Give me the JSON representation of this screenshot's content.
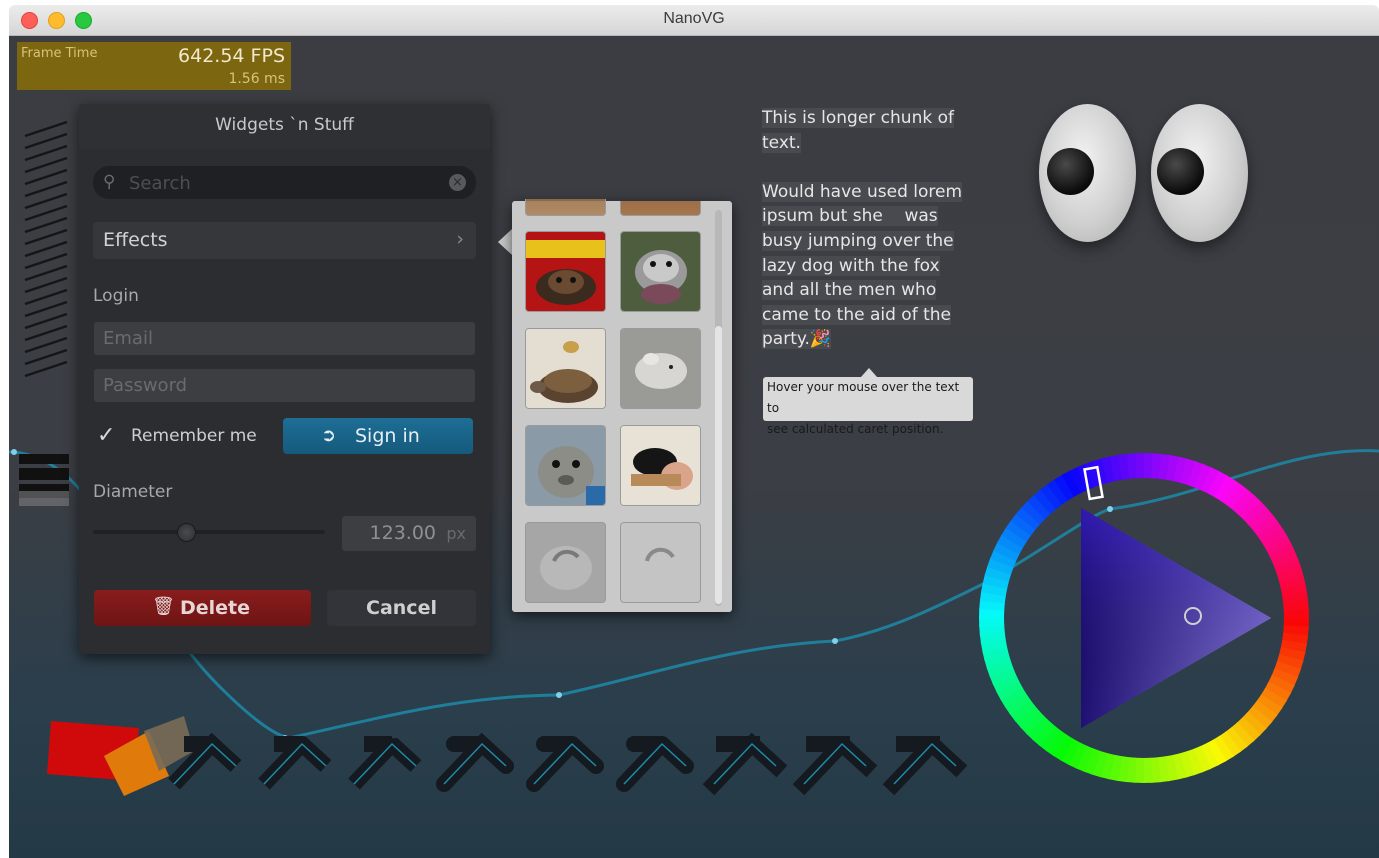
{
  "window": {
    "title": "NanoVG"
  },
  "perf": {
    "label": "Frame Time",
    "fps": "642.54 FPS",
    "ms": "1.56 ms"
  },
  "panel": {
    "title": "Widgets `n Stuff",
    "search_placeholder": "Search",
    "effects_label": "Effects",
    "login_label": "Login",
    "email_placeholder": "Email",
    "password_placeholder": "Password",
    "remember_label": "Remember me",
    "remember_checked": true,
    "signin_label": "Sign in",
    "diameter_label": "Diameter",
    "slider_value_fraction": 0.4,
    "diameter_value": "123.00",
    "diameter_unit": "px",
    "delete_label": "Delete",
    "cancel_label": "Cancel"
  },
  "image_popup": {
    "thumbnails": [
      "cat-in-red-hat",
      "opossum",
      "tortoise",
      "mouse",
      "seal",
      "puppy-sleeping",
      "loading",
      "loading"
    ],
    "scroll_fraction": 0.3
  },
  "paragraph": {
    "p1_lines": [
      "This is longer chunk of",
      "text."
    ],
    "p2_lines": [
      "Would have used lorem",
      "ipsum but she    was",
      "busy jumping over the",
      "lazy dog with the fox",
      "and all the men who",
      "came to the aid of the",
      "party.🎉"
    ]
  },
  "tooltip": {
    "line1": "Hover your mouse over the text to",
    "line2": "see calculated caret position."
  },
  "colors": {
    "titlebar": "#d6d6d6",
    "canvas_top": "#3c3d42",
    "canvas_bottom": "#243946",
    "perf_bg": "#7c6610",
    "signin": "#1e6e96",
    "delete": "#8a1c1c",
    "curve": "#1d8aa8"
  },
  "icons": {
    "search": "search-icon",
    "clear": "clear-icon",
    "chevron": "chevron-right-icon",
    "check": "checkmark-icon",
    "signin": "login-icon",
    "delete": "trash-icon"
  }
}
